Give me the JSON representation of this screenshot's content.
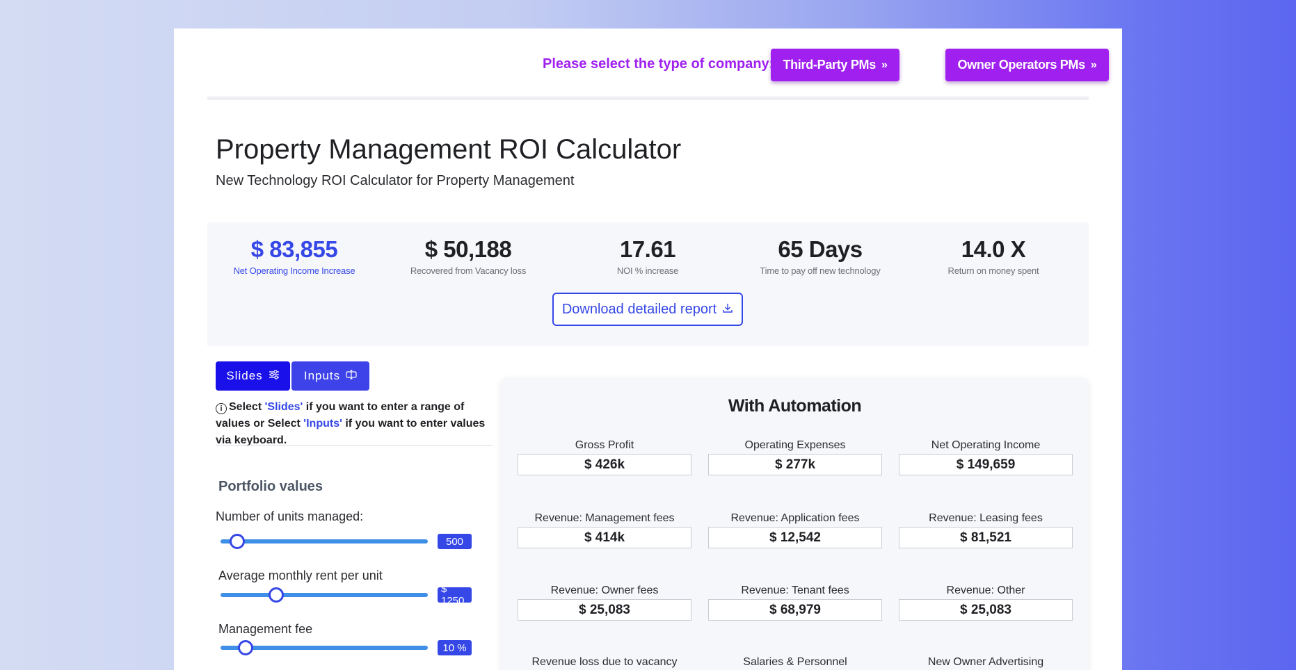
{
  "header": {
    "select_label": "Please select the type of company:",
    "buttons": [
      {
        "label": "Third-Party PMs",
        "icon": "double-chevron-right"
      },
      {
        "label": "Owner Operators PMs",
        "icon": "double-chevron-right"
      }
    ]
  },
  "page": {
    "title": "Property Management ROI Calculator",
    "subtitle": "New Technology ROI Calculator for Property Management"
  },
  "stats": [
    {
      "value": "$ 83,855",
      "label": "Net Operating Income Increase",
      "accent": true
    },
    {
      "value": "$ 50,188",
      "label": "Recovered from Vacancy loss"
    },
    {
      "value": "17.61",
      "label": "NOI % increase"
    },
    {
      "value": "65 Days",
      "label": "Time to pay off new technology"
    },
    {
      "value": "14.0 X",
      "label": "Return on money spent"
    }
  ],
  "download": {
    "label": "Download detailed report",
    "icon": "download-icon"
  },
  "tabs": [
    {
      "label": "Slides",
      "icon": "sliders-icon",
      "active": true
    },
    {
      "label": "Inputs",
      "icon": "input-field-icon",
      "active": false
    }
  ],
  "hint": {
    "p1": "Select ",
    "slides": "'Slides'",
    "p2": " if you want to enter a range of values or Select ",
    "inputs": "'Inputs'",
    "p3": " if you want to enter values via keyboard."
  },
  "portfolio": {
    "heading": "Portfolio values",
    "sliders": [
      {
        "label": "Number of units managed:",
        "value": "500",
        "level": 0.08
      },
      {
        "label": "Average monthly rent per unit",
        "value": "$ 1250",
        "level": 0.27
      },
      {
        "label": "Management fee",
        "value": "10 %",
        "level": 0.12
      }
    ]
  },
  "automation": {
    "title": "With Automation",
    "metrics": [
      {
        "label": "Gross Profit",
        "value": "$ 426k"
      },
      {
        "label": "Operating Expenses",
        "value": "$ 277k"
      },
      {
        "label": "Net Operating Income",
        "value": "$ 149,659"
      },
      {
        "label": "Revenue: Management fees",
        "value": "$ 414k"
      },
      {
        "label": "Revenue: Application fees",
        "value": "$ 12,542"
      },
      {
        "label": "Revenue: Leasing fees",
        "value": "$ 81,521"
      },
      {
        "label": "Revenue: Owner fees",
        "value": "$ 25,083"
      },
      {
        "label": "Revenue: Tenant fees",
        "value": "$ 68,979"
      },
      {
        "label": "Revenue: Other",
        "value": "$ 25,083"
      },
      {
        "label": "Revenue loss due to vacancy",
        "value": ""
      },
      {
        "label": "Salaries & Personnel",
        "value": ""
      },
      {
        "label": "New Owner Advertising",
        "value": ""
      }
    ]
  },
  "colors": {
    "accent": "#3547e6",
    "brand_purple": "#a020f0",
    "active_tab": "#1a10ea"
  }
}
